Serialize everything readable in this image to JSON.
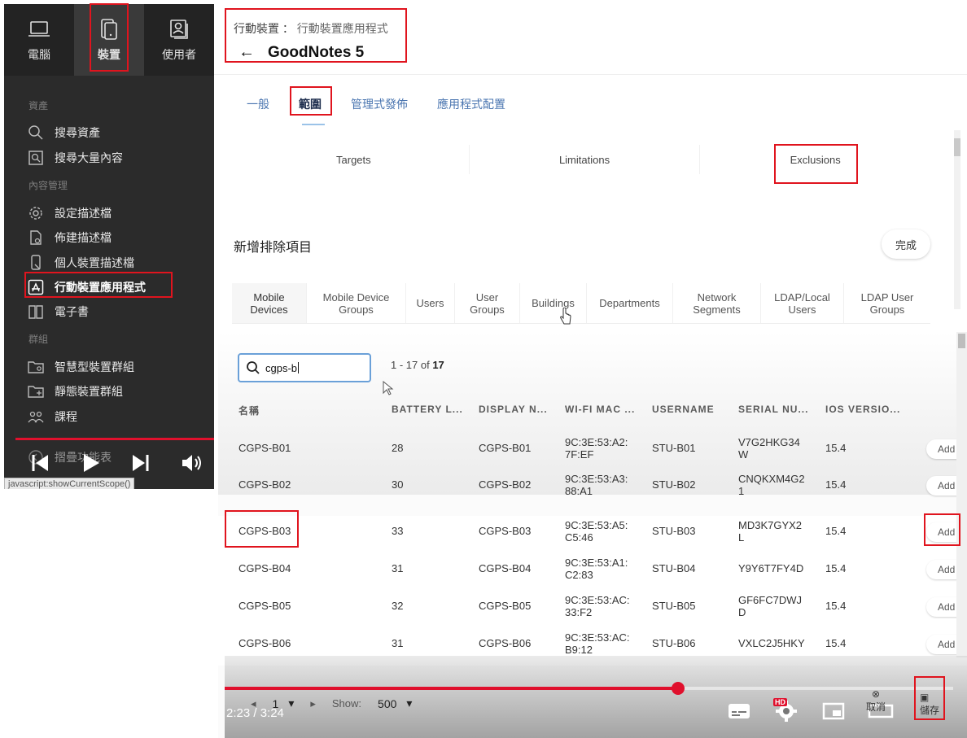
{
  "sidebar": {
    "top_tabs": [
      {
        "label": "電腦",
        "icon": "laptop-icon"
      },
      {
        "label": "裝置",
        "icon": "mobile-device-icon",
        "active": true
      },
      {
        "label": "使用者",
        "icon": "user-card-icon"
      }
    ],
    "sections": {
      "assets": "資產",
      "content": "內容管理",
      "groups": "群組"
    },
    "items": [
      {
        "label": "搜尋資產",
        "icon": "search-icon"
      },
      {
        "label": "搜尋大量內容",
        "icon": "bulk-search-icon"
      },
      {
        "label": "設定描述檔",
        "icon": "gear-icon"
      },
      {
        "label": "佈建描述檔",
        "icon": "document-icon"
      },
      {
        "label": "個人裝置描述檔",
        "icon": "personal-device-icon"
      },
      {
        "label": "行動裝置應用程式",
        "icon": "app-store-icon",
        "active": true
      },
      {
        "label": "電子書",
        "icon": "book-icon"
      },
      {
        "label": "智慧型裝置群組",
        "icon": "smart-folder-icon"
      },
      {
        "label": "靜態裝置群組",
        "icon": "static-folder-icon"
      },
      {
        "label": "課程",
        "icon": "classes-icon"
      },
      {
        "label": "摺疊功能表",
        "icon": "collapse-icon"
      }
    ],
    "status_url": "javascript:showCurrentScope()"
  },
  "header": {
    "breadcrumb_parent": "行動裝置",
    "breadcrumb_sep": "：",
    "breadcrumb_current": "行動裝置應用程式",
    "back_arrow": "←",
    "title": "GoodNotes 5"
  },
  "tabs": [
    {
      "label": "一般"
    },
    {
      "label": "範圍",
      "active": true
    },
    {
      "label": "管理式發佈"
    },
    {
      "label": "應用程式配置"
    }
  ],
  "scope_segments": [
    "Targets",
    "Limitations",
    "Exclusions"
  ],
  "exclusions": {
    "title": "新增排除項目",
    "done_label": "完成",
    "categories": [
      "Mobile\nDevices",
      "Mobile Device\nGroups",
      "Users",
      "User\nGroups",
      "Buildings",
      "Departments",
      "Network\nSegments",
      "LDAP/Local\nUsers",
      "LDAP User\nGroups"
    ]
  },
  "search": {
    "value": "cgps-b"
  },
  "paging": {
    "range": "1 - 17 of ",
    "total": "17"
  },
  "columns": [
    "名稱",
    "BATTERY L...",
    "DISPLAY N...",
    "WI-FI MAC ...",
    "USERNAME",
    "SERIAL NU...",
    "IOS VERSIO..."
  ],
  "rows": [
    {
      "name": "CGPS-B01",
      "battery": "28",
      "display": "CGPS-B01",
      "mac": "9C:3E:53:A2:\n7F:EF",
      "user": "STU-B01",
      "serial": "V7G2HKG34\nW",
      "ios": "15.4",
      "action": "Add"
    },
    {
      "name": "CGPS-B02",
      "battery": "30",
      "display": "CGPS-B02",
      "mac": "9C:3E:53:A3:\n88:A1",
      "user": "STU-B02",
      "serial": "CNQKXM4G2\n1",
      "ios": "15.4",
      "action": "Add"
    },
    {
      "name": "CGPS-B03",
      "battery": "33",
      "display": "CGPS-B03",
      "mac": "9C:3E:53:A5:\nC5:46",
      "user": "STU-B03",
      "serial": "MD3K7GYX2\nL",
      "ios": "15.4",
      "action": "Add"
    },
    {
      "name": "CGPS-B04",
      "battery": "31",
      "display": "CGPS-B04",
      "mac": "9C:3E:53:A1:\nC2:83",
      "user": "STU-B04",
      "serial": "Y9Y6T7FY4D",
      "ios": "15.4",
      "action": "Add"
    },
    {
      "name": "CGPS-B05",
      "battery": "32",
      "display": "CGPS-B05",
      "mac": "9C:3E:53:AC:\n33:F2",
      "user": "STU-B05",
      "serial": "GF6FC7DWJ\nD",
      "ios": "15.4",
      "action": "Add"
    },
    {
      "name": "CGPS-B06",
      "battery": "31",
      "display": "CGPS-B06",
      "mac": "9C:3E:53:AC:\nB9:12",
      "user": "STU-B06",
      "serial": "VXLC2J5HKY",
      "ios": "15.4",
      "action": "Add"
    }
  ],
  "pager": {
    "page": "1",
    "show_label": "Show:",
    "show_value": "500"
  },
  "video": {
    "time": "2:23 / 3:24",
    "progress": 0.62,
    "hd_badge": "HD",
    "cancel_label": "取消",
    "save_label": "儲存"
  },
  "colors": {
    "accent_red": "#e0141e",
    "link_blue": "#4a75b0",
    "sidebar_bg": "#2b2b2b"
  }
}
